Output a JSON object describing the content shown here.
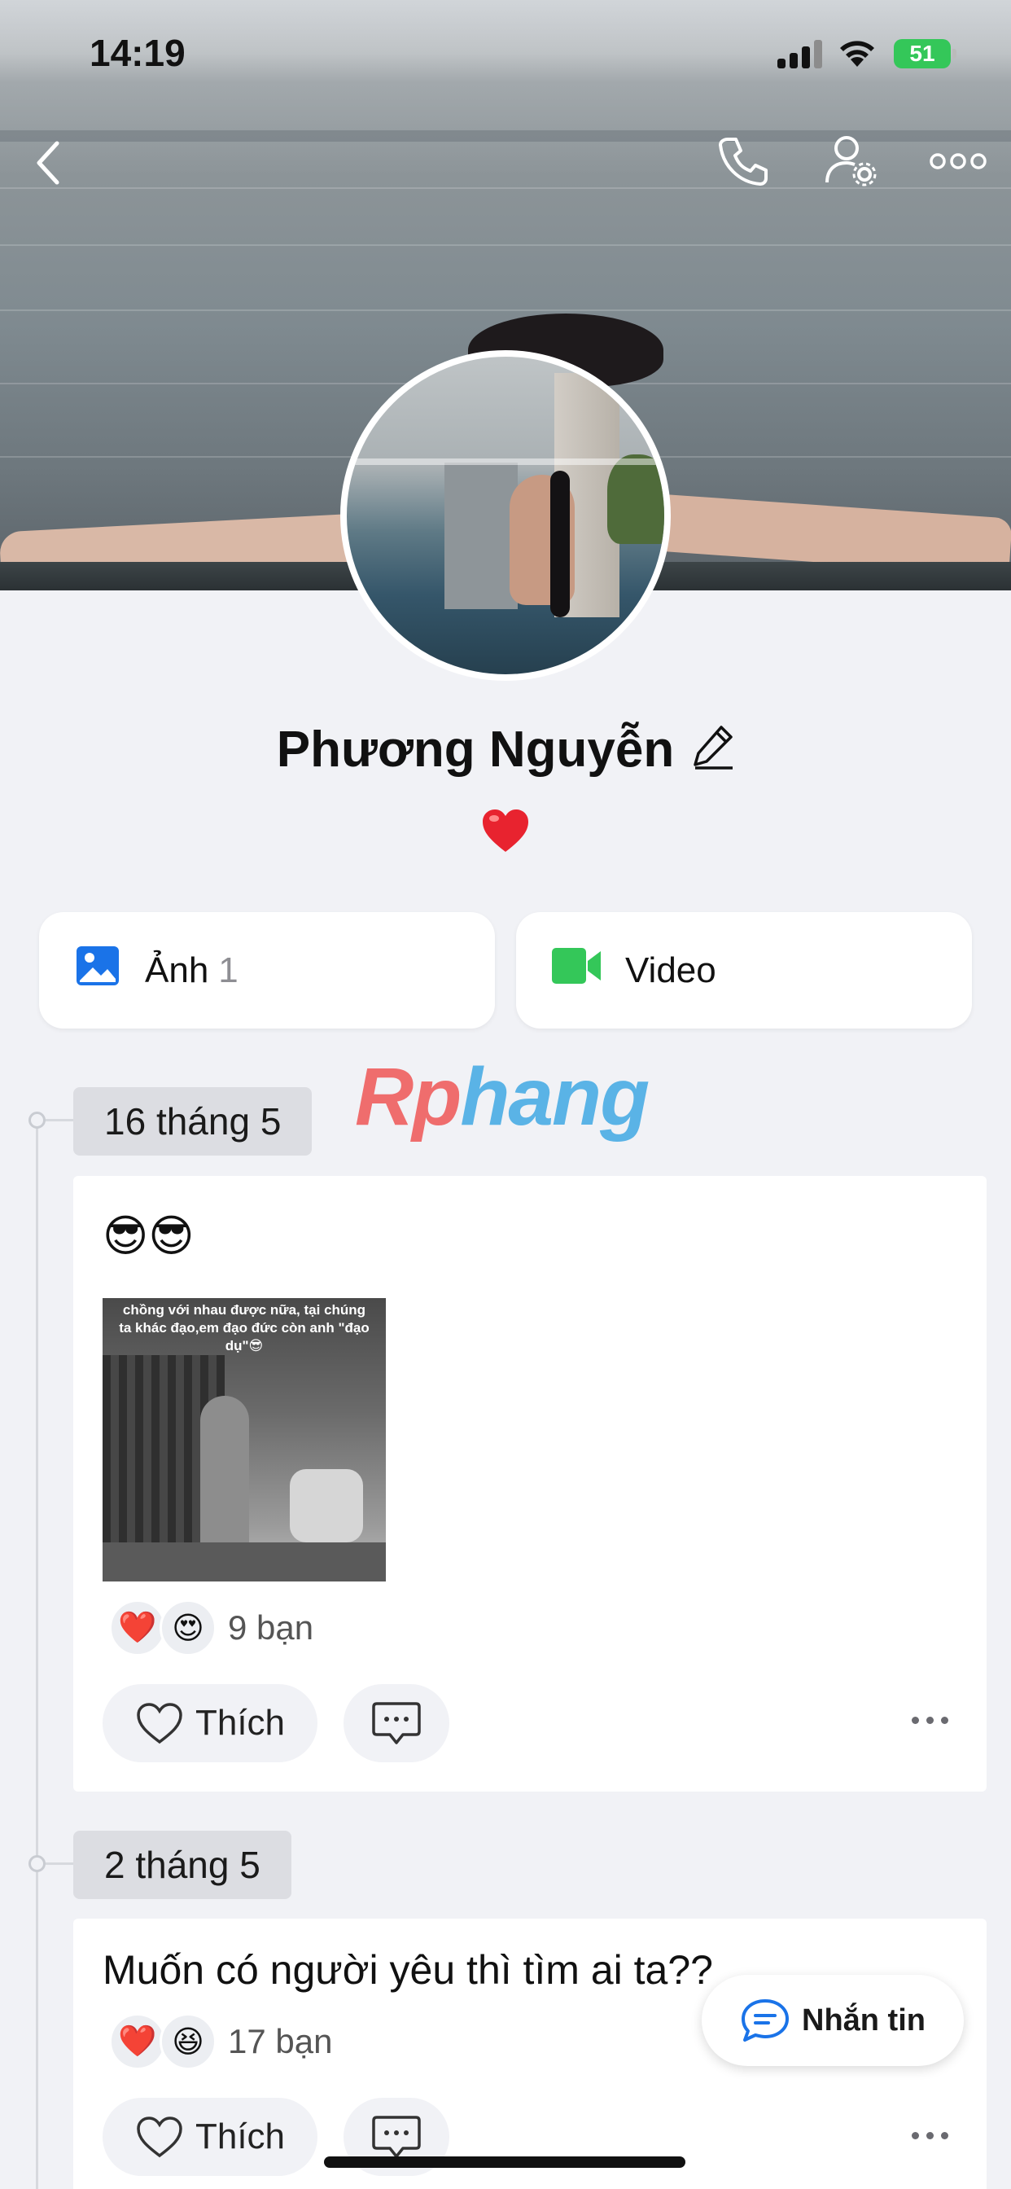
{
  "status_bar": {
    "time": "14:19",
    "battery": "51"
  },
  "top_bar": {
    "icons": [
      "back-icon",
      "phone-icon",
      "user-settings-icon",
      "more-icon"
    ]
  },
  "profile": {
    "name": "Phương Nguyễn",
    "status_emoji": "❤️"
  },
  "media_cards": [
    {
      "label": "Ảnh",
      "count": "1",
      "icon": "photo-icon",
      "accent": "#1a73e8"
    },
    {
      "label": "Video",
      "icon": "video-icon",
      "accent": "#34c759"
    }
  ],
  "watermark": {
    "part1": "Rp",
    "part2": "hang"
  },
  "posts": [
    {
      "date": "16 tháng 5",
      "text": "😎😎",
      "image_caption": "chồng với nhau được nữa, tại chúng ta khác đạo,em đạo đức còn anh \"đạo dụ\"😎",
      "reactions": [
        "❤️",
        "😍"
      ],
      "reaction_count": "9 bạn",
      "like_label": "Thích"
    },
    {
      "date": "2 tháng 5",
      "text": "Muốn có người yêu thì tìm ai ta??",
      "reactions": [
        "❤️",
        "😆"
      ],
      "reaction_count": "17 bạn",
      "like_label": "Thích"
    }
  ],
  "message_button": {
    "label": "Nhắn tin"
  }
}
